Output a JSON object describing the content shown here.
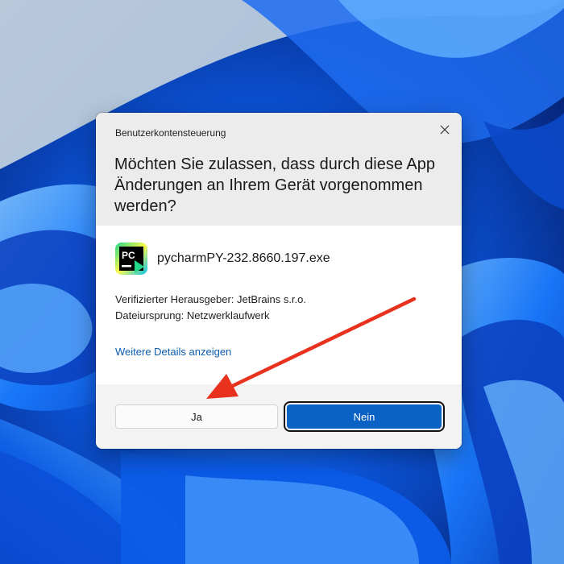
{
  "uac_dialog": {
    "window_title": "Benutzerkontensteuerung",
    "question": "Möchten Sie zulassen, dass durch diese App Änderungen an Ihrem Gerät vorgenommen werden?",
    "app": {
      "name": "pycharmPY-232.8660.197.exe",
      "icon": "pycharm-icon"
    },
    "publisher_line": "Verifizierter Herausgeber: JetBrains s.r.o.",
    "origin_line": "Dateiursprung: Netzwerklaufwerk",
    "details_link": "Weitere Details anzeigen",
    "buttons": {
      "yes": "Ja",
      "no": "Nein"
    },
    "close_icon": "close-icon"
  },
  "annotation": {
    "type": "arrow",
    "color": "#e8321e",
    "points_to": "yes-button"
  },
  "colors": {
    "accent_button": "#0a62c4",
    "link": "#0b5cad",
    "header_bg": "#ececec",
    "footer_bg": "#f3f3f3"
  }
}
